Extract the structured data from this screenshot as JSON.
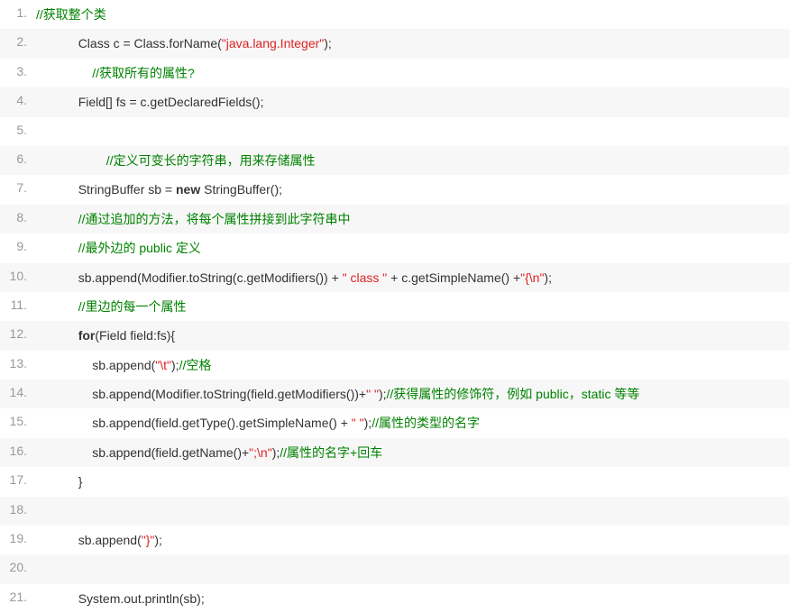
{
  "lines": [
    {
      "num": "1.",
      "zebra": false,
      "tokens": [
        {
          "type": "comment",
          "text": "//获取整个类"
        }
      ],
      "leading_spaces": 0
    },
    {
      "num": "2.",
      "zebra": true,
      "tokens": [
        {
          "type": "plain",
          "text": "Class c = Class.forName("
        },
        {
          "type": "string",
          "text": "\"java.lang.Integer\""
        },
        {
          "type": "plain",
          "text": ");"
        }
      ],
      "leading_spaces": 12
    },
    {
      "num": "3.",
      "zebra": false,
      "tokens": [
        {
          "type": "comment",
          "text": "//获取所有的属性?"
        }
      ],
      "leading_spaces": 16
    },
    {
      "num": "4.",
      "zebra": true,
      "tokens": [
        {
          "type": "plain",
          "text": "Field[] fs = c.getDeclaredFields();"
        }
      ],
      "leading_spaces": 12
    },
    {
      "num": "5.",
      "zebra": false,
      "tokens": [],
      "leading_spaces": 0
    },
    {
      "num": "6.",
      "zebra": true,
      "tokens": [
        {
          "type": "comment",
          "text": "//定义可变长的字符串，用来存储属性"
        }
      ],
      "leading_spaces": 20
    },
    {
      "num": "7.",
      "zebra": false,
      "tokens": [
        {
          "type": "plain",
          "text": "StringBuffer sb = "
        },
        {
          "type": "keyword",
          "text": "new"
        },
        {
          "type": "plain",
          "text": " StringBuffer();"
        }
      ],
      "leading_spaces": 12
    },
    {
      "num": "8.",
      "zebra": true,
      "tokens": [
        {
          "type": "comment",
          "text": "//通过追加的方法，将每个属性拼接到此字符串中"
        }
      ],
      "leading_spaces": 12
    },
    {
      "num": "9.",
      "zebra": false,
      "tokens": [
        {
          "type": "comment",
          "text": "//最外边的 public 定义"
        }
      ],
      "leading_spaces": 12
    },
    {
      "num": "10.",
      "zebra": true,
      "tokens": [
        {
          "type": "plain",
          "text": "sb.append(Modifier.toString(c.getModifiers()) + "
        },
        {
          "type": "string",
          "text": "\" class \""
        },
        {
          "type": "plain",
          "text": " + c.getSimpleName() +"
        },
        {
          "type": "string",
          "text": "\"{\\n\""
        },
        {
          "type": "plain",
          "text": ");"
        }
      ],
      "leading_spaces": 12
    },
    {
      "num": "11.",
      "zebra": false,
      "tokens": [
        {
          "type": "comment",
          "text": "//里边的每一个属性"
        }
      ],
      "leading_spaces": 12
    },
    {
      "num": "12.",
      "zebra": true,
      "tokens": [
        {
          "type": "keyword",
          "text": "for"
        },
        {
          "type": "plain",
          "text": "(Field field:fs){"
        }
      ],
      "leading_spaces": 12
    },
    {
      "num": "13.",
      "zebra": false,
      "tokens": [
        {
          "type": "plain",
          "text": "sb.append("
        },
        {
          "type": "string",
          "text": "\"\\t\""
        },
        {
          "type": "plain",
          "text": ");"
        },
        {
          "type": "comment",
          "text": "//空格"
        }
      ],
      "leading_spaces": 16
    },
    {
      "num": "14.",
      "zebra": true,
      "tokens": [
        {
          "type": "plain",
          "text": "sb.append(Modifier.toString(field.getModifiers())+"
        },
        {
          "type": "string",
          "text": "\" \""
        },
        {
          "type": "plain",
          "text": ");"
        },
        {
          "type": "comment",
          "text": "//获得属性的修饰符，例如 public，static 等等"
        }
      ],
      "leading_spaces": 16
    },
    {
      "num": "15.",
      "zebra": false,
      "tokens": [
        {
          "type": "plain",
          "text": "sb.append(field.getType().getSimpleName() + "
        },
        {
          "type": "string",
          "text": "\" \""
        },
        {
          "type": "plain",
          "text": ");"
        },
        {
          "type": "comment",
          "text": "//属性的类型的名字"
        }
      ],
      "leading_spaces": 16
    },
    {
      "num": "16.",
      "zebra": true,
      "tokens": [
        {
          "type": "plain",
          "text": "sb.append(field.getName()+"
        },
        {
          "type": "string",
          "text": "\";\\n\""
        },
        {
          "type": "plain",
          "text": ");"
        },
        {
          "type": "comment",
          "text": "//属性的名字+回车"
        }
      ],
      "leading_spaces": 16
    },
    {
      "num": "17.",
      "zebra": false,
      "tokens": [
        {
          "type": "plain",
          "text": "}"
        }
      ],
      "leading_spaces": 12
    },
    {
      "num": "18.",
      "zebra": true,
      "tokens": [],
      "leading_spaces": 0
    },
    {
      "num": "19.",
      "zebra": false,
      "tokens": [
        {
          "type": "plain",
          "text": "sb.append("
        },
        {
          "type": "string",
          "text": "\"}\""
        },
        {
          "type": "plain",
          "text": ");"
        }
      ],
      "leading_spaces": 12
    },
    {
      "num": "20.",
      "zebra": true,
      "tokens": [],
      "leading_spaces": 0
    },
    {
      "num": "21.",
      "zebra": false,
      "tokens": [
        {
          "type": "plain",
          "text": "System.out.println(sb);"
        }
      ],
      "leading_spaces": 12
    }
  ]
}
